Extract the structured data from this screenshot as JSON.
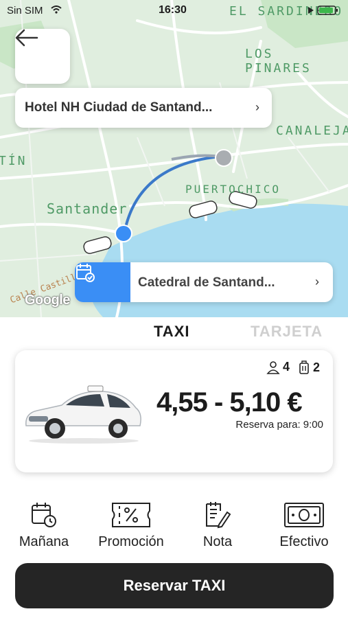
{
  "status_bar": {
    "carrier": "Sin SIM",
    "time": "16:30"
  },
  "map": {
    "labels": [
      "EL SARDINERO",
      "LOS PINARES",
      "CANALEJAS",
      "TÍN",
      "Santander",
      "PUERTOCHICO",
      "Calle Castilla"
    ],
    "provider": "Google"
  },
  "origin": {
    "label": "Hotel NH Ciudad de Santand..."
  },
  "destination": {
    "label": "Catedral de Santand..."
  },
  "tabs": {
    "taxi": "TAXI",
    "tarjeta": "TARJETA"
  },
  "ride": {
    "passengers": "4",
    "luggage": "2",
    "price": "4,55  - 5,10 €",
    "reserva": "Reserva para: 9:00"
  },
  "options": {
    "manana": "Mañana",
    "promocion": "Promoción",
    "nota": "Nota",
    "efectivo": "Efectivo"
  },
  "cta": {
    "label": "Reservar TAXI"
  },
  "colors": {
    "accent": "#3a8ef5",
    "button": "#252525",
    "map_land": "#dfeee0",
    "map_water": "#a9dcf1"
  }
}
